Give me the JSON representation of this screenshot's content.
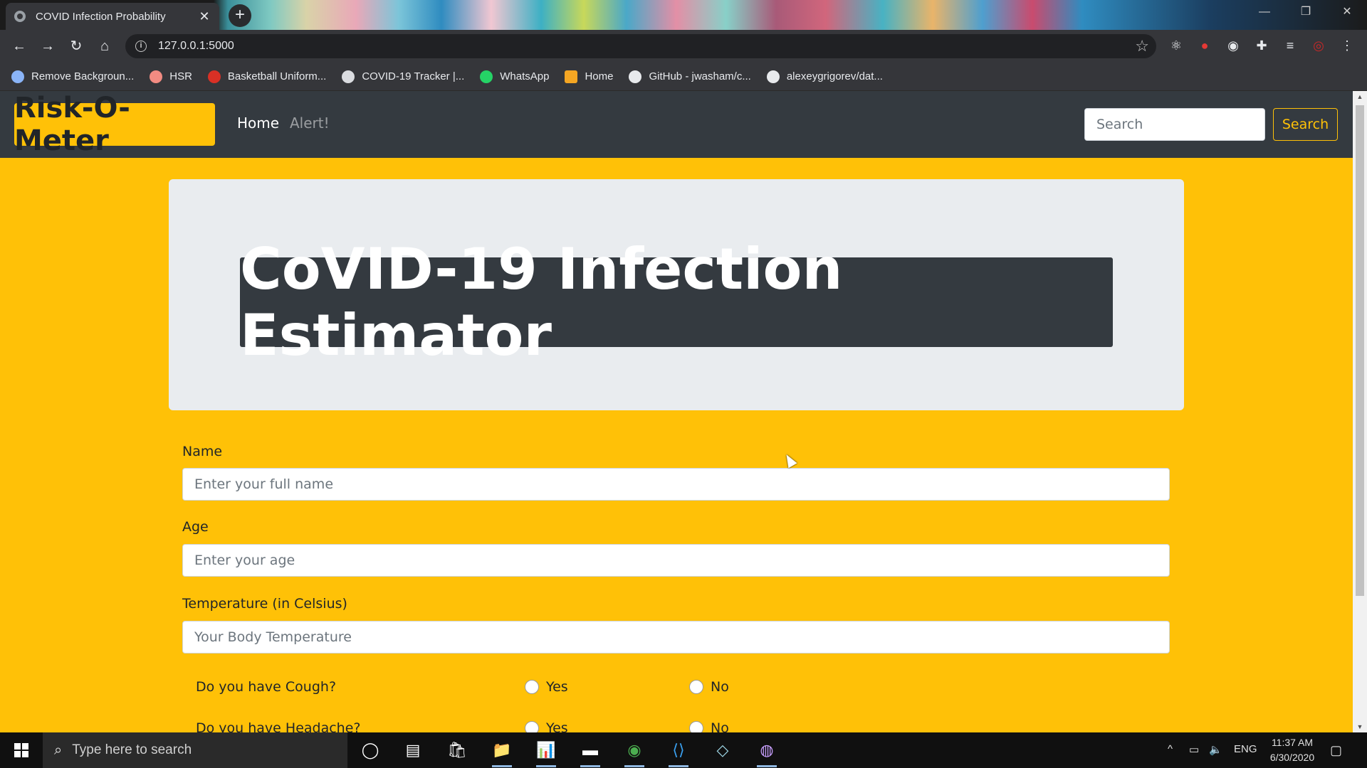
{
  "browser": {
    "tab_title": "COVID Infection Probability",
    "tab_close": "✕",
    "new_tab": "+",
    "window_controls": {
      "minimize": "—",
      "restore": "❐",
      "close": "✕"
    },
    "nav": {
      "back": "←",
      "forward": "→",
      "reload": "↻",
      "home": "⌂"
    },
    "url": "127.0.0.1:5000",
    "info_icon": "i",
    "star_icon": "☆",
    "extensions": [
      "⚛",
      "●",
      "◉",
      "✚",
      "≡",
      "◎",
      "⋮"
    ],
    "bookmarks": [
      {
        "label": "Remove Backgroun...",
        "color": "#8ab4f8"
      },
      {
        "label": "HSR",
        "color": "#f28b82"
      },
      {
        "label": "Basketball Uniform...",
        "color": "#d93025"
      },
      {
        "label": "COVID-19 Tracker |...",
        "color": "#dadce0"
      },
      {
        "label": "WhatsApp",
        "color": "#25d366"
      },
      {
        "label": "Home",
        "color": "#f5a623"
      },
      {
        "label": "GitHub - jwasham/c...",
        "color": "#e8eaed"
      },
      {
        "label": "alexeygrigorev/dat...",
        "color": "#e8eaed"
      }
    ]
  },
  "page": {
    "brand": "Risk-O-Meter",
    "nav_home": "Home",
    "nav_alert": "Alert!",
    "search_placeholder": "Search",
    "search_button": "Search",
    "heading": "CoVID-19 Infection Estimator",
    "form": {
      "name_label": "Name",
      "name_placeholder": "Enter your full name",
      "age_label": "Age",
      "age_placeholder": "Enter your age",
      "temp_label": "Temperature (in Celsius)",
      "temp_placeholder": "Your Body Temperature",
      "q_cough": "Do you have Cough?",
      "q_headache": "Do you have Headache?",
      "yes": "Yes",
      "no": "No"
    },
    "accent_color": "#ffc107",
    "navbar_color": "#343a40"
  },
  "taskbar": {
    "search_placeholder": "Type here to search",
    "search_icon": "⌕",
    "apps": [
      "◯",
      "▤",
      "🛍",
      "📁",
      "📊",
      "▬",
      "◉",
      "⟨⟩",
      "◇",
      "◍"
    ],
    "tray": {
      "chevron": "^",
      "battery": "▭",
      "volume": "🔈",
      "lang": "ENG",
      "notify": "▢"
    },
    "time": "11:37 AM",
    "date": "6/30/2020"
  }
}
